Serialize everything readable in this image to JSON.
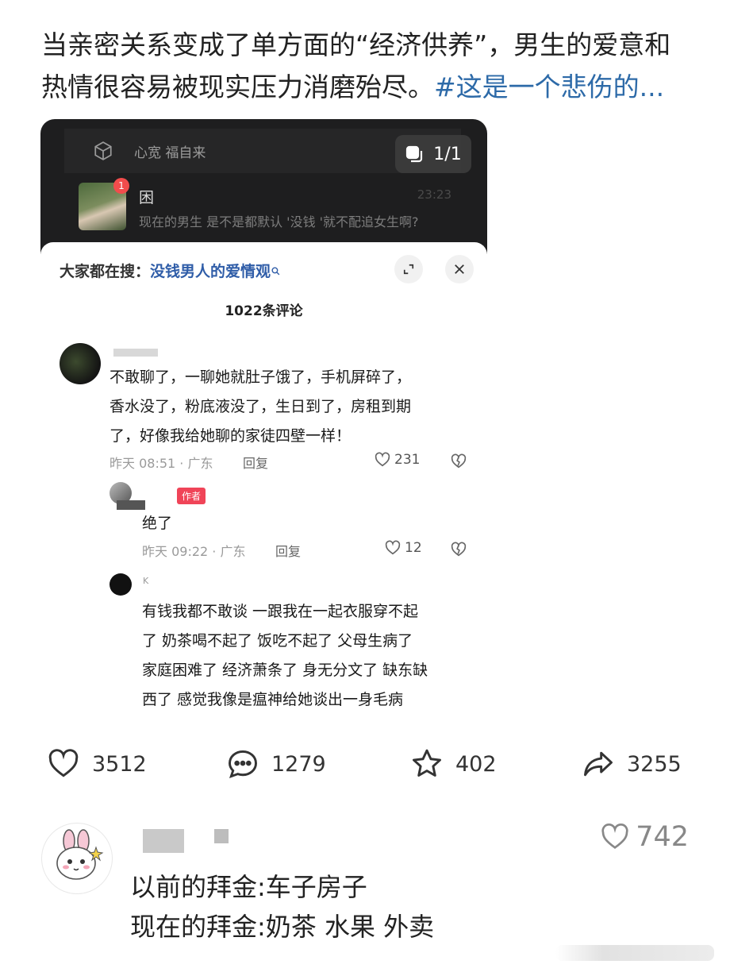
{
  "post": {
    "text": "当亲密关系变成了单方面的“经济供养”，男生的爱意和热情很容易被现实压力消磨殆尽。",
    "hashtag": "#这是一个悲伤的..."
  },
  "embed": {
    "header_title": "心宽 福自来",
    "page_indicator": "1/1",
    "chat": {
      "name": "困",
      "badge": "1",
      "time": "23:23",
      "preview": "现在的男生 是不是都默认 '没钱 '就不配追女生啊?"
    },
    "sheet": {
      "search_prefix": "大家都在搜：",
      "search_keyword": "没钱男人的爱情观",
      "count": "1022条评论"
    },
    "comments": [
      {
        "text_lines": [
          "不敢聊了，一聊她就肚子饿了，手机屏碎了，",
          "香水没了，粉底液没了，生日到了，房租到期",
          "了，好像我给她聊的家徒四壁一样！"
        ],
        "meta": "昨天 08:51 · 广东",
        "reply_label": "回复",
        "likes": "231"
      },
      {
        "author_tag": "作者",
        "text_lines": [
          "绝了"
        ],
        "meta": "昨天 09:22 · 广东",
        "reply_label": "回复",
        "likes": "12"
      },
      {
        "name": "K",
        "text_lines": [
          "有钱我都不敢谈 一跟我在一起衣服穿不起",
          "了 奶茶喝不起了 饭吃不起了 父母生病了",
          "家庭困难了 经济萧条了 身无分文了 缺东缺",
          "西了 感觉我像是瘟神给她谈出一身毛病"
        ]
      }
    ]
  },
  "actions": {
    "like_count": "3512",
    "comment_count": "1279",
    "favorite_count": "402",
    "share_count": "3255"
  },
  "reply": {
    "likes": "742",
    "line1": "以前的拜金:车子房子",
    "line2": "现在的拜金:奶茶 水果 外卖"
  }
}
